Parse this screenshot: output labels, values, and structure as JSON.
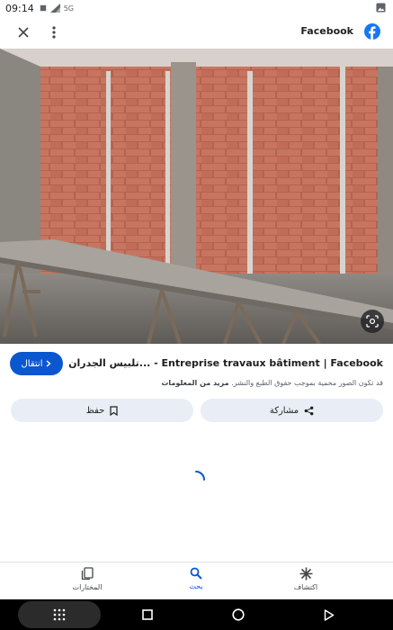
{
  "status_bar": {
    "time": "09:14",
    "network": "5G"
  },
  "top_bar": {
    "source_name": "Facebook"
  },
  "result": {
    "visit_label": "انتقال",
    "title": "Entreprise travaux bâtiment | Facebook - ...تلبيس الجدران الداخلية ب💥",
    "notice_text": "قد تكون الصور محمية بموجب حقوق الطبع والنشر.",
    "notice_more": "مزيد من المعلومات"
  },
  "actions": {
    "save_label": "حفظ",
    "share_label": "مشاركة"
  },
  "bottom_nav": {
    "saved_label": "المختارات",
    "search_label": "بحث",
    "discover_label": "اكتشاف"
  },
  "colors": {
    "accent": "#0b57d0",
    "chip_bg": "#e9eef6",
    "facebook_blue": "#1877f2"
  },
  "icons": [
    "close-icon",
    "more-vert-icon",
    "facebook-logo-icon",
    "lens-icon",
    "bookmark-icon",
    "share-icon",
    "chevron-icon"
  ]
}
